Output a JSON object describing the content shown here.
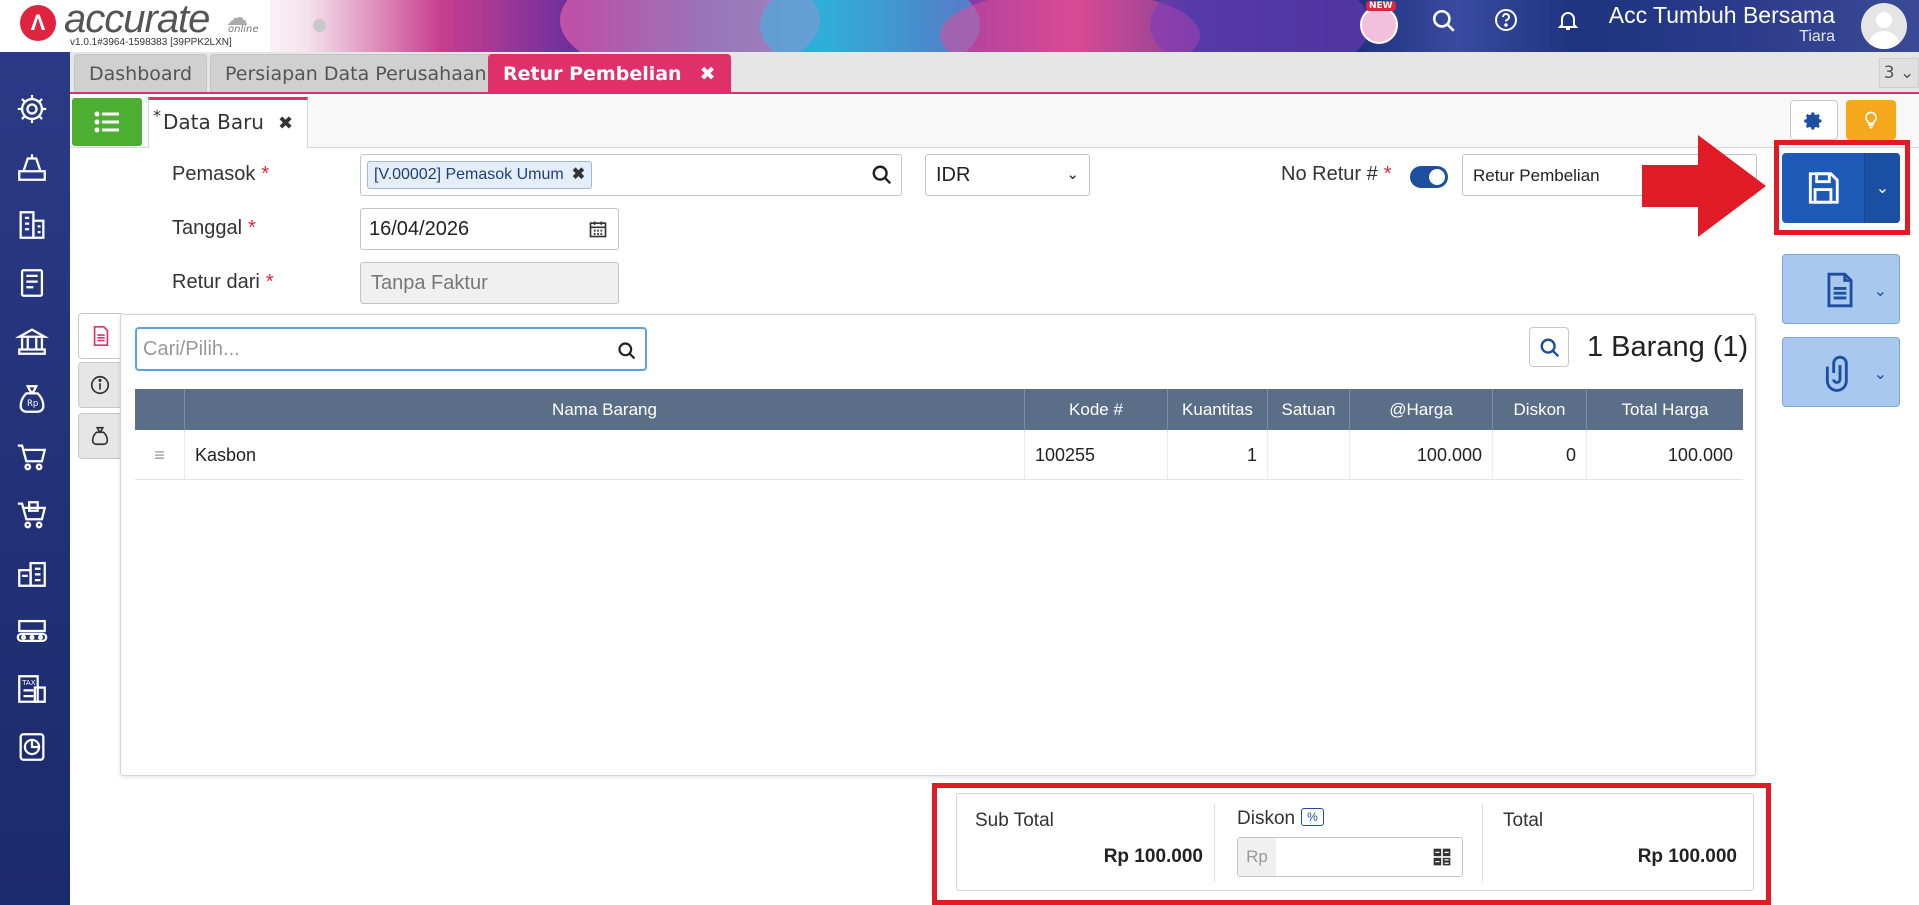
{
  "app": {
    "logo_text": "accurate",
    "logo_sub": "online",
    "version": "v1.0.1#3964-1598383 [39PPK2LXN]",
    "new_badge": "NEW",
    "company": "Acc Tumbuh Bersama",
    "user": "Tiara"
  },
  "tabs": [
    {
      "label": "Dashboard"
    },
    {
      "label": "Persiapan Data Perusahaan"
    },
    {
      "label": "Retur Pembelian",
      "close": "✖"
    }
  ],
  "tab_count": "3 ⌄",
  "subtab": {
    "star": "*",
    "label": "Data Baru",
    "close": "✖"
  },
  "form": {
    "pemasok_label": "Pemasok",
    "pemasok_value": "[V.00002] Pemasok Umum",
    "currency": "IDR",
    "noretur_label": "No Retur #",
    "noretur_value": "Retur Pembelian",
    "tanggal_label": "Tanggal",
    "tanggal_value": "16/04/2026",
    "returdari_label": "Retur dari",
    "returdari_value": "Tanpa Faktur",
    "required_mark": "*",
    "chip_close": "✖"
  },
  "items": {
    "search_placeholder": "Cari/Pilih...",
    "count_label": "1 Barang (1)",
    "columns": [
      "Nama Barang",
      "Kode #",
      "Kuantitas",
      "Satuan",
      "@Harga",
      "Diskon",
      "Total Harga"
    ],
    "rows": [
      {
        "handle": "≡",
        "nama": "Kasbon",
        "kode": "100255",
        "qty": "1",
        "satuan": "",
        "harga": "100.000",
        "diskon": "0",
        "total": "100.000"
      }
    ]
  },
  "totals": {
    "subtotal_label": "Sub Total",
    "subtotal_value": "Rp 100.000",
    "diskon_label": "Diskon",
    "diskon_pct": "%",
    "diskon_prefix": "Rp",
    "total_label": "Total",
    "total_value": "Rp 100.000"
  },
  "colors": {
    "accent": "#e0306a",
    "primary": "#1e5bb8",
    "highlight": "#e01b25",
    "sidebar": "#1b2a6a"
  },
  "icons": [
    "settings-icon",
    "scale-icon",
    "building-icon",
    "ledger-icon",
    "bank-icon",
    "money-bag-icon",
    "cart-icon",
    "cart-return-icon",
    "warehouse-icon",
    "conveyor-icon",
    "tax-icon",
    "report-icon"
  ]
}
